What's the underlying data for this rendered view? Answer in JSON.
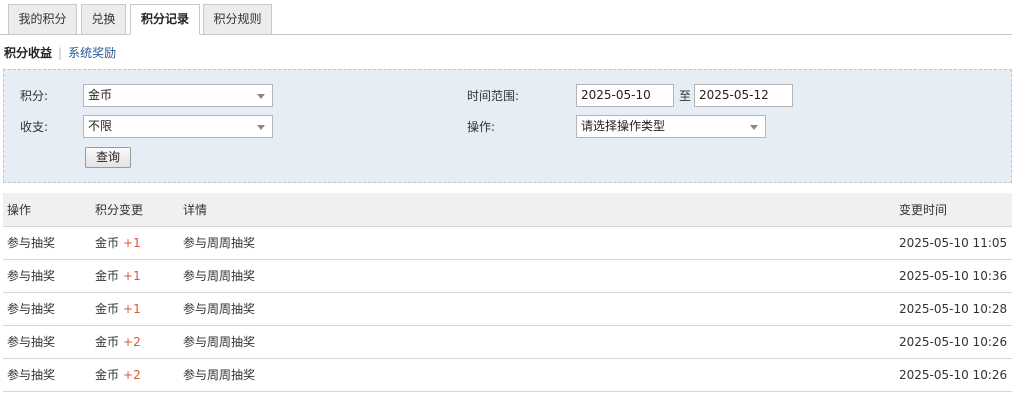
{
  "tabs": [
    {
      "label": "我的积分",
      "active": false
    },
    {
      "label": "兑换",
      "active": false
    },
    {
      "label": "积分记录",
      "active": true
    },
    {
      "label": "积分规则",
      "active": false
    }
  ],
  "subnav": {
    "active": "积分收益",
    "separator": "|",
    "link": "系统奖励"
  },
  "filter": {
    "points_label": "积分:",
    "points_value": "金币",
    "income_label": "收支:",
    "income_value": "不限",
    "time_label": "时间范围:",
    "date_from": "2025-05-10",
    "date_sep": "至",
    "date_to": "2025-05-12",
    "op_label": "操作:",
    "op_value": "请选择操作类型",
    "query_button": "查询"
  },
  "table": {
    "columns": [
      "操作",
      "积分变更",
      "详情",
      "变更时间"
    ],
    "rows": [
      {
        "action": "参与抽奖",
        "currency": "金币",
        "delta": "+1",
        "detail": "参与周周抽奖",
        "time": "2025-05-10 11:05"
      },
      {
        "action": "参与抽奖",
        "currency": "金币",
        "delta": "+1",
        "detail": "参与周周抽奖",
        "time": "2025-05-10 10:36"
      },
      {
        "action": "参与抽奖",
        "currency": "金币",
        "delta": "+1",
        "detail": "参与周周抽奖",
        "time": "2025-05-10 10:28"
      },
      {
        "action": "参与抽奖",
        "currency": "金币",
        "delta": "+2",
        "detail": "参与周周抽奖",
        "time": "2025-05-10 10:26"
      },
      {
        "action": "参与抽奖",
        "currency": "金币",
        "delta": "+2",
        "detail": "参与周周抽奖",
        "time": "2025-05-10 10:26"
      }
    ]
  },
  "colors": {
    "panel_bg": "#e6edf4",
    "delta": "#e0553a",
    "link": "#2b5a9b",
    "header_bg": "#f0f0f0"
  }
}
